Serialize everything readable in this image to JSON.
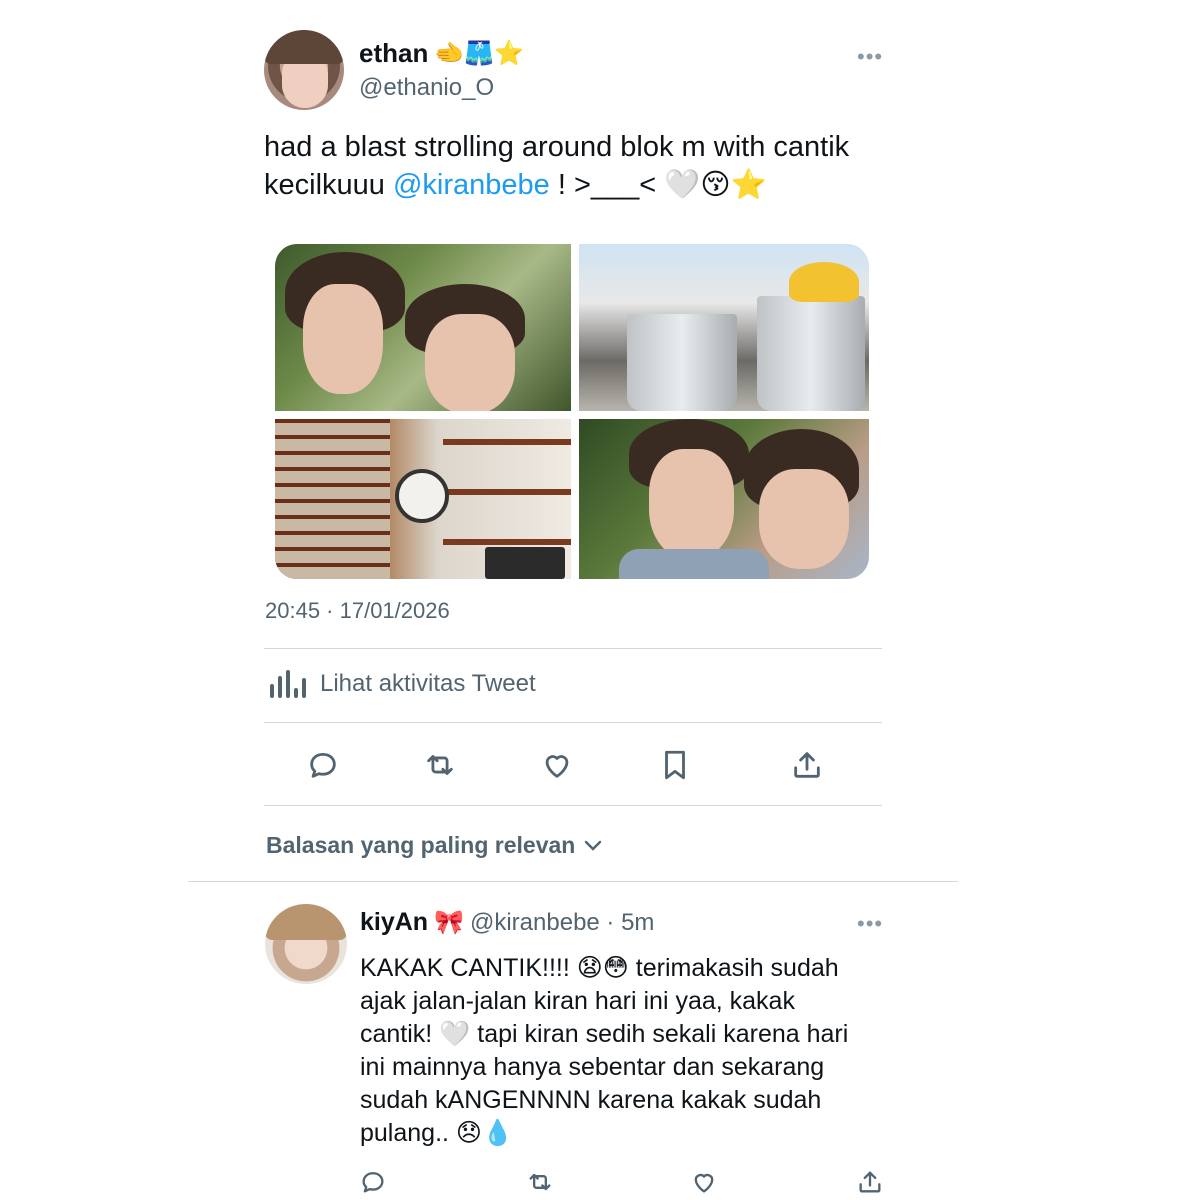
{
  "tweet": {
    "author": {
      "name": "ethan",
      "name_emojis": "🫲🩳⭐",
      "handle": "@ethanio_O"
    },
    "more_icon": "•••",
    "text_parts": {
      "line1": "had a blast strolling around blok m with cantik",
      "line2_prefix": "kecilkuuu ",
      "mention": "@kiranbebe",
      "line2_suffix": " ! >___< 🤍😚⭐"
    },
    "photos": [
      "selfie-two-boys",
      "ice-cream-cups",
      "record-store-shelves",
      "selfie-outdoors"
    ],
    "timestamp": "20:45 · 17/01/2026",
    "activity_label": "Lihat aktivitas Tweet",
    "actions": [
      "reply-icon",
      "retweet-icon",
      "like-icon",
      "bookmark-icon",
      "share-icon"
    ]
  },
  "replies_sort": {
    "label": "Balasan yang paling relevan",
    "icon": "chevron-down-icon"
  },
  "reply": {
    "name": "kiyAn",
    "name_emoji": "🎀",
    "handle_time": "@kiranbebe · 5m",
    "more_icon": "•••",
    "lines": [
      "KAKAK CANTIK!!!! 😧😳 terimakasih sudah",
      "ajak jalan-jalan kiran hari ini yaa, kakak",
      "cantik! 🤍 tapi kiran sedih sekali karena hari",
      "ini mainnya hanya sebentar dan sekarang",
      "sudah kANGENNNN karena kakak sudah",
      "pulang.. 😞💧"
    ],
    "actions": [
      "reply-icon",
      "retweet-icon",
      "like-icon",
      "share-icon"
    ]
  },
  "colors": {
    "accent": "#1d9bf0",
    "secondary_text": "#536471",
    "divider": "#cfd9de"
  }
}
